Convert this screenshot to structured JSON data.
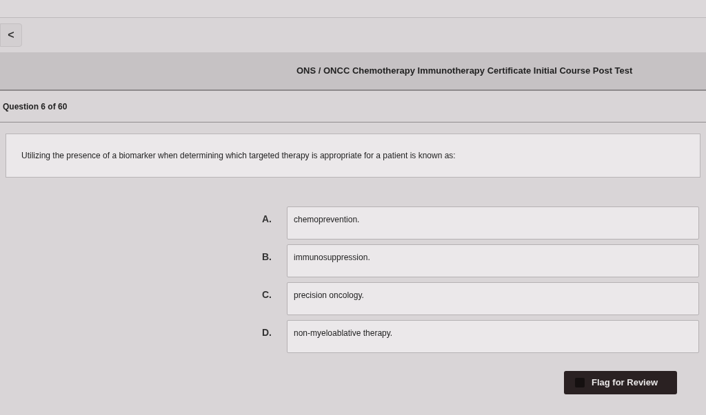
{
  "back_button": {
    "label": "<"
  },
  "header": {
    "title": "ONS / ONCC Chemotherapy Immunotherapy Certificate Initial Course Post Test"
  },
  "progress": {
    "label": "Question 6 of 60"
  },
  "question": {
    "text": "Utilizing the presence of a biomarker when determining which targeted therapy is appropriate for a patient is known as:"
  },
  "options": [
    {
      "letter": "A.",
      "text": "chemoprevention.",
      "selected": false
    },
    {
      "letter": "B.",
      "text": "immunosuppression.",
      "selected": false
    },
    {
      "letter": "C.",
      "text": "precision oncology.",
      "selected": false
    },
    {
      "letter": "D.",
      "text": "non-myeloablative therapy.",
      "selected": false
    }
  ],
  "flag_button": {
    "label": "Flag for Review",
    "checked": false
  }
}
